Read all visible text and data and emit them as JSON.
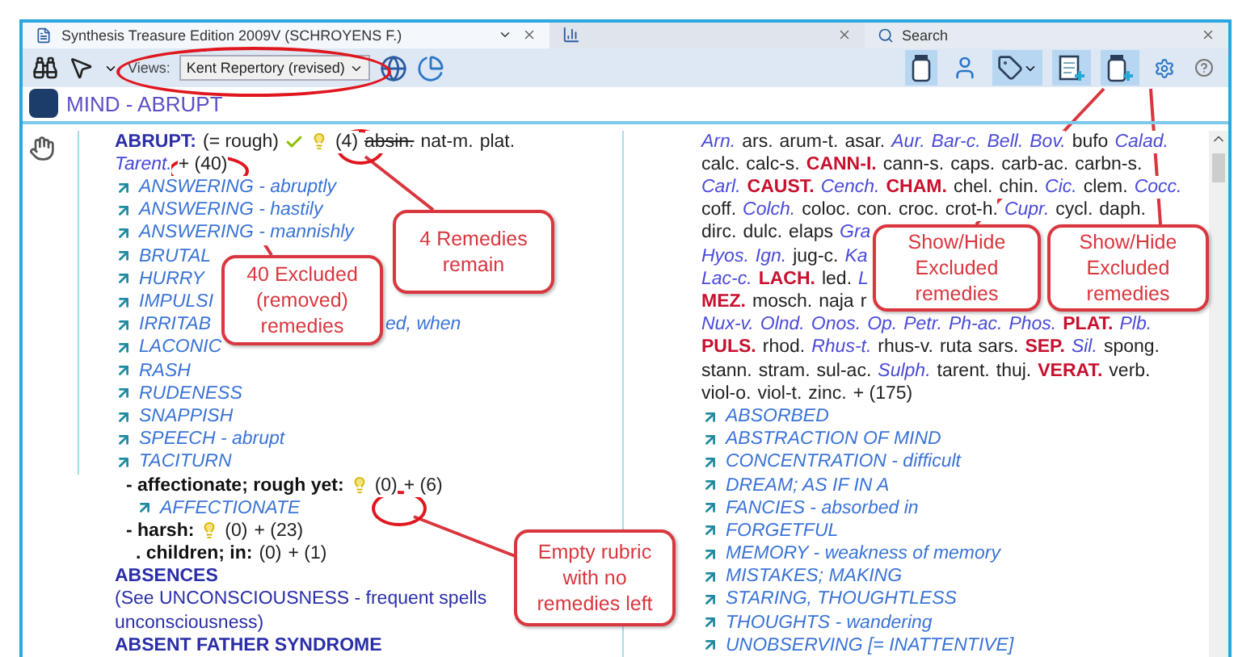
{
  "tabs": [
    {
      "kind": "document",
      "label": "Synthesis Treasure Edition 2009V (SCHROYENS F.)",
      "selected": true
    },
    {
      "kind": "chart",
      "selected": false
    },
    {
      "kind": "search",
      "label": "Search",
      "selected": false
    }
  ],
  "toolbar": {
    "views_label": "Views:",
    "views_value": "Kent Repertory (revised)",
    "buttons": [
      {
        "kind": "jar",
        "pressed": true
      },
      {
        "kind": "person",
        "pressed": false
      },
      {
        "kind": "tag",
        "pressed": true
      },
      {
        "kind": "doc-plus",
        "pressed": true
      },
      {
        "kind": "jar-plus",
        "pressed": true
      },
      {
        "kind": "gear",
        "pressed": false
      },
      {
        "kind": "help",
        "pressed": false
      }
    ]
  },
  "chapter_title": "MIND - ABRUPT",
  "rubric": {
    "label": "ABRUPT:",
    "synonym": "(= rough)",
    "count": "(4)",
    "remedies": [
      {
        "text": "absin.",
        "excluded": true
      },
      {
        "text": "nat-m.",
        "excluded": false
      },
      {
        "text": "plat.",
        "excluded": false
      }
    ],
    "remedies_line_2": [
      {
        "text": "Tarent.",
        "excluded": false
      }
    ],
    "excluded_count": "+ (40)",
    "cross_references": [
      {
        "text": "ANSWERING - abruptly"
      },
      {
        "text": "ANSWERING - hastily"
      },
      {
        "text": "ANSWERING - mannishly"
      },
      {
        "text": "BRUTAL"
      },
      {
        "text": "HURRY"
      },
      {
        "text": "IMPULSI"
      },
      {
        "text": "IRRITAB",
        "tail": "ed, when"
      },
      {
        "text": "LACONIC"
      },
      {
        "text": "RASH"
      },
      {
        "text": "RUDENESS"
      },
      {
        "text": "SNAPPISH"
      },
      {
        "text": "SPEECH - abrupt"
      },
      {
        "text": "TACITURN"
      }
    ],
    "subrubrics": [
      {
        "label": "- affectionate; rough yet:",
        "bulb": true,
        "count": "(0)",
        "excluded_count": "+ (6)",
        "cross_references": [
          "AFFECTIONATE"
        ]
      },
      {
        "label": "- harsh:",
        "bulb": true,
        "count": "(0)",
        "excluded_count": "+ (23)",
        "children": [
          {
            "label": ". children; in:",
            "bulb": false,
            "count": "(0)",
            "excluded_count": "+ (1)"
          }
        ]
      }
    ]
  },
  "next_rubrics": [
    {
      "label": "ABSENCES",
      "see": [
        "(See UNCONSCIOUSNESS - frequent spells",
        "unconsciousness)"
      ]
    },
    {
      "label": "ABSENT FATHER SYNDROME"
    }
  ],
  "remedy_lines": [
    [
      {
        "text": "Arn.",
        "kind": "italic"
      },
      {
        "text": "ars.",
        "kind": "plain"
      },
      {
        "text": "arum-t.",
        "kind": "plain"
      },
      {
        "text": "asar.",
        "kind": "plain"
      },
      {
        "text": "Aur.",
        "kind": "italic"
      },
      {
        "text": "Bar-c.",
        "kind": "italic"
      },
      {
        "text": "Bell.",
        "kind": "italic"
      },
      {
        "text": "Bov.",
        "kind": "italic"
      },
      {
        "text": "bufo",
        "kind": "plain"
      },
      {
        "text": "Calad.",
        "kind": "italic"
      }
    ],
    [
      {
        "text": "calc.",
        "kind": "plain"
      },
      {
        "text": "calc-s.",
        "kind": "plain"
      },
      {
        "text": "CANN-I.",
        "kind": "bold"
      },
      {
        "text": "cann-s.",
        "kind": "plain"
      },
      {
        "text": "caps.",
        "kind": "plain"
      },
      {
        "text": "carb-ac.",
        "kind": "plain"
      },
      {
        "text": "carbn-s.",
        "kind": "plain"
      }
    ],
    [
      {
        "text": "Carl.",
        "kind": "italic"
      },
      {
        "text": "CAUST.",
        "kind": "bold"
      },
      {
        "text": "Cench.",
        "kind": "italic"
      },
      {
        "text": "CHAM.",
        "kind": "bold"
      },
      {
        "text": "chel.",
        "kind": "plain"
      },
      {
        "text": "chin.",
        "kind": "plain"
      },
      {
        "text": "Cic.",
        "kind": "italic"
      },
      {
        "text": "clem.",
        "kind": "plain"
      },
      {
        "text": "Cocc.",
        "kind": "italic"
      }
    ],
    [
      {
        "text": "coff.",
        "kind": "plain"
      },
      {
        "text": "Colch.",
        "kind": "italic"
      },
      {
        "text": "coloc.",
        "kind": "plain"
      },
      {
        "text": "con.",
        "kind": "plain"
      },
      {
        "text": "croc.",
        "kind": "plain"
      },
      {
        "text": "crot-h.",
        "kind": "plain"
      },
      {
        "text": "Cupr.",
        "kind": "italic"
      },
      {
        "text": "cycl.",
        "kind": "plain"
      },
      {
        "text": "daph.",
        "kind": "plain"
      }
    ],
    [
      {
        "text": "dirc.",
        "kind": "plain"
      },
      {
        "text": "dulc.",
        "kind": "plain"
      },
      {
        "text": "elaps",
        "kind": "plain"
      },
      {
        "text": "Gra",
        "kind": "italic"
      }
    ],
    [
      {
        "text": "Hyos.",
        "kind": "italic"
      },
      {
        "text": "Ign.",
        "kind": "italic"
      },
      {
        "text": "jug-c.",
        "kind": "plain"
      },
      {
        "text": "Ka",
        "kind": "italic"
      }
    ],
    [
      {
        "text": "Lac-c.",
        "kind": "italic"
      },
      {
        "text": "LACH.",
        "kind": "bold"
      },
      {
        "text": "led.",
        "kind": "plain"
      },
      {
        "text": "L",
        "kind": "italic"
      }
    ],
    [
      {
        "text": "MEZ.",
        "kind": "bold"
      },
      {
        "text": "mosch.",
        "kind": "plain"
      },
      {
        "text": "naja",
        "kind": "plain"
      },
      {
        "text": "r",
        "kind": "plain"
      }
    ],
    [
      {
        "text": "Nux-v.",
        "kind": "italic"
      },
      {
        "text": "Olnd.",
        "kind": "italic"
      },
      {
        "text": "Onos.",
        "kind": "italic"
      },
      {
        "text": "Op.",
        "kind": "italic"
      },
      {
        "text": "Petr.",
        "kind": "italic"
      },
      {
        "text": "Ph-ac.",
        "kind": "italic"
      },
      {
        "text": "Phos.",
        "kind": "italic"
      },
      {
        "text": "PLAT.",
        "kind": "bold"
      },
      {
        "text": "Plb.",
        "kind": "italic"
      }
    ],
    [
      {
        "text": "PULS.",
        "kind": "bold"
      },
      {
        "text": "rhod.",
        "kind": "plain"
      },
      {
        "text": "Rhus-t.",
        "kind": "italic"
      },
      {
        "text": "rhus-v.",
        "kind": "plain"
      },
      {
        "text": "ruta",
        "kind": "plain"
      },
      {
        "text": "sars.",
        "kind": "plain"
      },
      {
        "text": "SEP.",
        "kind": "bold"
      },
      {
        "text": "Sil.",
        "kind": "italic"
      },
      {
        "text": "spong.",
        "kind": "plain"
      }
    ],
    [
      {
        "text": "stann.",
        "kind": "plain"
      },
      {
        "text": "stram.",
        "kind": "plain"
      },
      {
        "text": "sul-ac.",
        "kind": "plain"
      },
      {
        "text": "Sulph.",
        "kind": "italic"
      },
      {
        "text": "tarent.",
        "kind": "plain"
      },
      {
        "text": "thuj.",
        "kind": "plain"
      },
      {
        "text": "VERAT.",
        "kind": "bold"
      },
      {
        "text": "verb.",
        "kind": "plain"
      }
    ],
    [
      {
        "text": "viol-o.",
        "kind": "plain"
      },
      {
        "text": "viol-t.",
        "kind": "plain"
      },
      {
        "text": "zinc.",
        "kind": "plain"
      },
      {
        "text": "+ (175)",
        "kind": "plain"
      }
    ]
  ],
  "right_cross_references": [
    "ABSORBED",
    "ABSTRACTION OF MIND",
    "CONCENTRATION - difficult",
    "DREAM; AS IF IN A",
    "FANCIES - absorbed in",
    "FORGETFUL",
    "MEMORY - weakness of memory",
    "MISTAKES; MAKING",
    "STARING, THOUGHTLESS",
    "THOUGHTS - wandering",
    "UNOBSERVING [= INATTENTIVE]"
  ],
  "annotations": [
    {
      "kind": "callout",
      "lines": [
        "40 Excluded",
        "(removed)",
        "remedies"
      ]
    },
    {
      "kind": "callout",
      "lines": [
        "4 Remedies",
        "remain"
      ]
    },
    {
      "kind": "callout",
      "lines": [
        "Show/Hide",
        "Excluded",
        "remedies"
      ]
    },
    {
      "kind": "callout",
      "lines": [
        "Show/Hide",
        "Excluded",
        "remedies"
      ]
    },
    {
      "kind": "callout",
      "lines": [
        "Empty rubric",
        "with no",
        "remedies left"
      ]
    }
  ]
}
